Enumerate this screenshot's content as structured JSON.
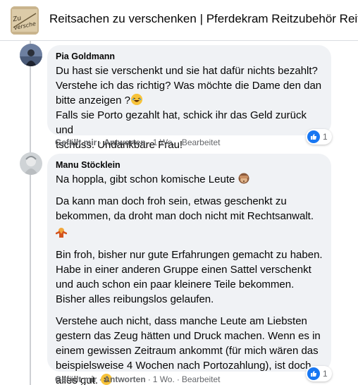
{
  "header": {
    "title": "Reitsachen zu verschenken | Pferdekram Reitzubehör Reits",
    "avatar_text": "Zu verschen"
  },
  "comments": [
    {
      "author": "Pia Goldmann",
      "paragraphs": [
        "Du hast sie verschenkt und sie hat dafür nichts bezahlt?",
        "Verstehe ich das richtig? Was möchte die Dame den dan",
        "bitte anzeigen ?",
        "Falls sie Porto gezahlt hat, schick ihr das Geld zurück und",
        "tschüss. Undankbare Frau!"
      ],
      "actions": {
        "like": "Gefällt mir",
        "reply": "Antworten",
        "time": "1 Wo.",
        "edited": "Bearbeitet"
      },
      "reaction_count": "1",
      "reaction_icon": "like-icon"
    },
    {
      "author": "Manu Stöcklein",
      "paragraphs": [
        "Na hoppla, gibt schon komische Leute",
        "Da kann man doch froh sein, etwas geschenkt zu bekommen, da droht man doch nicht mit Rechtsanwalt.",
        "Bin froh, bisher nur gute Erfahrungen gemacht zu haben. Habe in einer anderen Gruppe einen Sattel verschenkt und auch schon ein paar kleinere Teile bekommen. Bisher alles reibungslos gelaufen.",
        "Verstehe auch nicht, dass manche Leute am Liebsten gestern das Zeug hätten und Druck machen. Wenn es in einem gewissen Zeitraum ankommt (für mich wären das beispielsweise 4 Wochen nach Portozahlung), ist doch alles gut."
      ],
      "actions": {
        "like": "Gefällt mir",
        "reply": "Antworten",
        "time": "1 Wo.",
        "edited": "Bearbeitet"
      },
      "reaction_count": "1",
      "reaction_icon": "like-icon"
    }
  ],
  "colors": {
    "like_blue": "#1877f2",
    "bubble": "#f0f2f5",
    "meta": "#65676b"
  }
}
